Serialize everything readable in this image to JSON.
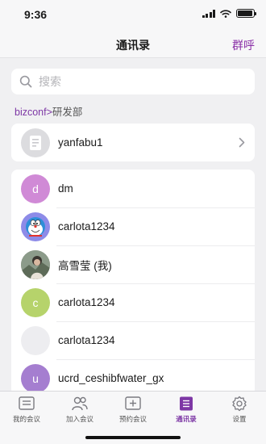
{
  "status_bar": {
    "time": "9:36",
    "battery_level": 0.95
  },
  "nav": {
    "title": "通讯录",
    "right_action": "群呼"
  },
  "search": {
    "placeholder": "搜索"
  },
  "breadcrumb": {
    "link": "bizconf>",
    "current": "研发部"
  },
  "department": {
    "name": "yanfabu1"
  },
  "members": [
    {
      "name": "dm",
      "avatar_letter": "d",
      "avatar_color": "#d08ad6",
      "avatar_type": "letter"
    },
    {
      "name": "carlota1234",
      "avatar_letter": "",
      "avatar_color": "#8d8be8",
      "avatar_type": "doraemon"
    },
    {
      "name": "高雪莹 (我)",
      "avatar_letter": "",
      "avatar_color": "#9a9a88",
      "avatar_type": "photo"
    },
    {
      "name": "carlota1234",
      "avatar_letter": "c",
      "avatar_color": "#b6d36b",
      "avatar_type": "letter"
    },
    {
      "name": "carlota1234",
      "avatar_letter": "",
      "avatar_color": "#ededf0",
      "avatar_type": "blank"
    },
    {
      "name": "ucrd_ceshibfwater_gx",
      "avatar_letter": "u",
      "avatar_color": "#a57ed0",
      "avatar_type": "letter"
    }
  ],
  "tabs": [
    {
      "label": "我的会议",
      "icon": "meeting-list-icon",
      "active": false
    },
    {
      "label": "加入会议",
      "icon": "join-meeting-icon",
      "active": false
    },
    {
      "label": "预约会议",
      "icon": "schedule-meeting-icon",
      "active": false
    },
    {
      "label": "通讯录",
      "icon": "contacts-icon",
      "active": true
    },
    {
      "label": "设置",
      "icon": "settings-icon",
      "active": false
    }
  ],
  "colors": {
    "accent": "#7d37a5",
    "background": "#f0f0f2"
  }
}
